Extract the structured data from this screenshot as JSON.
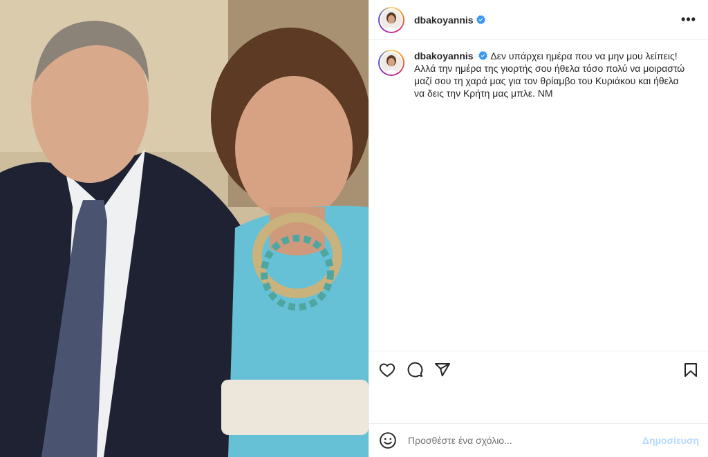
{
  "post": {
    "username": "dbakoyannis",
    "verified": true,
    "more_label": "•••",
    "caption": {
      "username": "dbakoyannis",
      "text": "Δεν υπάρχει ημέρα που να μην μου λείπεις! Αλλά την ημέρα της γιορτής σου ήθελα τόσο πολύ να μοιραστώ μαζί σου τη χαρά μας για τον θρίαμβο του Κυριάκου και ήθελα να δεις την Κρήτη μας μπλε. ΝΜ"
    }
  },
  "actions": {
    "like_icon": "heart-icon",
    "comment_icon": "comment-icon",
    "share_icon": "send-icon",
    "save_icon": "bookmark-icon"
  },
  "comment": {
    "placeholder": "Προσθέστε ένα σχόλιο...",
    "post_label": "Δημοσίευση"
  },
  "colors": {
    "verified": "#3897f0",
    "post_button_disabled": "#b3dbff",
    "text": "#262626",
    "border": "#efefef"
  }
}
